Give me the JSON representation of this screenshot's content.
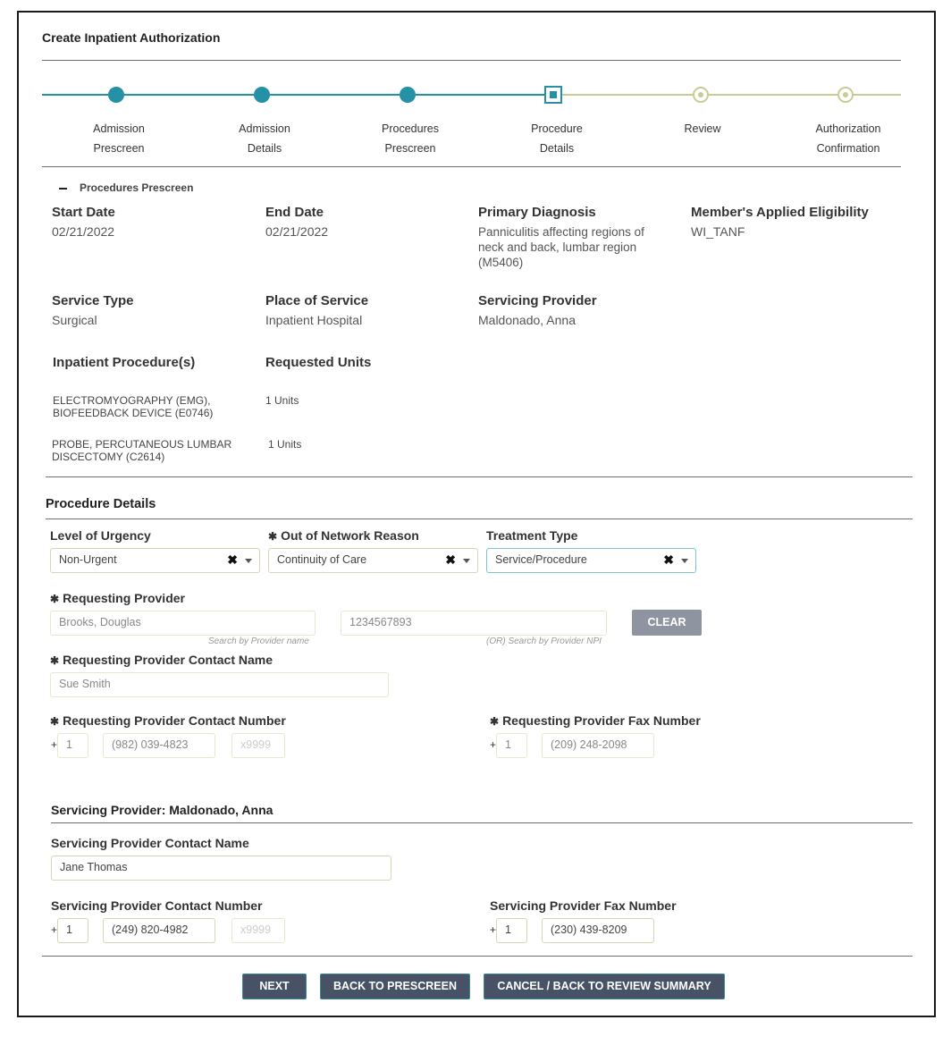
{
  "page_title": "Create Inpatient Authorization",
  "colors": {
    "completed": "#2591a6",
    "pending": "#c8cc94",
    "button": "#475266",
    "clear_button": "#8e95a1"
  },
  "stepper": {
    "current_index": 3,
    "steps": [
      {
        "line1": "Admission",
        "line2": "Prescreen",
        "state": "completed"
      },
      {
        "line1": "Admission",
        "line2": "Details",
        "state": "completed"
      },
      {
        "line1": "Procedures",
        "line2": "Prescreen",
        "state": "completed"
      },
      {
        "line1": "Procedure",
        "line2": "Details",
        "state": "current"
      },
      {
        "line1": "Review",
        "line2": "",
        "state": "pending"
      },
      {
        "line1": "Authorization",
        "line2": "Confirmation",
        "state": "pending"
      }
    ]
  },
  "summary": {
    "collapse_label": "Procedures Prescreen",
    "start_date": {
      "label": "Start Date",
      "value": "02/21/2022"
    },
    "end_date": {
      "label": "End Date",
      "value": "02/21/2022"
    },
    "primary_diagnosis": {
      "label": "Primary Diagnosis",
      "value": "Panniculitis affecting regions of neck and back, lumbar region (M5406)"
    },
    "eligibility": {
      "label": "Member's Applied Eligibility",
      "value": "WI_TANF"
    },
    "service_type": {
      "label": "Service Type",
      "value": "Surgical"
    },
    "place_of_service": {
      "label": "Place of Service",
      "value": "Inpatient Hospital"
    },
    "servicing_provider": {
      "label": "Servicing Provider",
      "value": "Maldonado, Anna"
    },
    "procedures_header": "Inpatient Procedure(s)",
    "units_header": "Requested Units",
    "procedures": [
      {
        "name": "ELECTROMYOGRAPHY (EMG), BIOFEEDBACK DEVICE (E0746)",
        "units": "1 Units"
      },
      {
        "name": "PROBE, PERCUTANEOUS LUMBAR DISCECTOMY (C2614)",
        "units": "1 Units"
      }
    ]
  },
  "procedure_details": {
    "title": "Procedure Details",
    "required_mark": "✱",
    "urgency": {
      "label": "Level of Urgency",
      "value": "Non-Urgent"
    },
    "out_of_network": {
      "label": "Out of Network Reason",
      "value": "Continuity of Care"
    },
    "treatment_type": {
      "label": "Treatment Type",
      "value": "Service/Procedure"
    },
    "clear_icon": "✖",
    "requesting_provider": {
      "label": "Requesting Provider",
      "name_value": "Brooks, Douglas",
      "name_hint": "Search by Provider name",
      "npi_value": "1234567893",
      "npi_hint": "(OR) Search by Provider NPI",
      "clear_label": "CLEAR"
    },
    "contact_name": {
      "label": "Requesting Provider Contact Name",
      "value": "Sue Smith"
    },
    "contact_number": {
      "label": "Requesting Provider Contact Number",
      "plus": "+",
      "country": "1",
      "phone": "(982) 039-4823",
      "ext_placeholder": "x9999"
    },
    "fax_number": {
      "label": "Requesting Provider Fax Number",
      "plus": "+",
      "country": "1",
      "fax": "(209) 248-2098"
    }
  },
  "servicing": {
    "title": "Servicing Provider: Maldonado, Anna",
    "contact_name": {
      "label": "Servicing Provider Contact Name",
      "value": "Jane Thomas"
    },
    "contact_number": {
      "label": "Servicing Provider Contact Number",
      "plus": "+",
      "country": "1",
      "phone": "(249) 820-4982",
      "ext_placeholder": "x9999"
    },
    "fax_number": {
      "label": "Servicing Provider Fax Number",
      "plus": "+",
      "country": "1",
      "fax": "(230) 439-8209"
    }
  },
  "buttons": {
    "next": "NEXT",
    "back": "BACK TO PRESCREEN",
    "cancel": "CANCEL / BACK TO REVIEW SUMMARY"
  }
}
